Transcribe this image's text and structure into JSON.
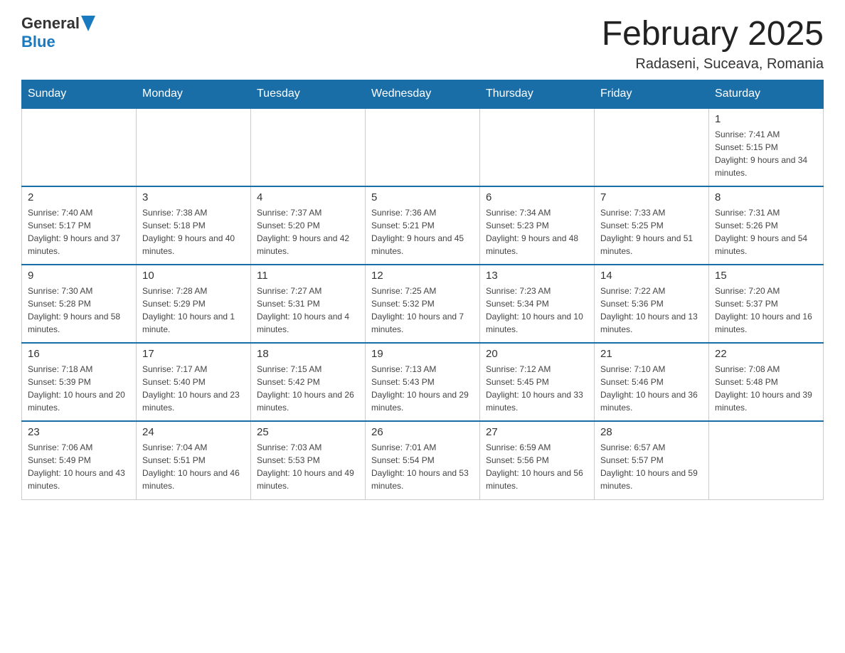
{
  "header": {
    "logo": {
      "general": "General",
      "blue": "Blue"
    },
    "title": "February 2025",
    "location": "Radaseni, Suceava, Romania"
  },
  "weekdays": [
    "Sunday",
    "Monday",
    "Tuesday",
    "Wednesday",
    "Thursday",
    "Friday",
    "Saturday"
  ],
  "weeks": [
    [
      {
        "day": "",
        "info": ""
      },
      {
        "day": "",
        "info": ""
      },
      {
        "day": "",
        "info": ""
      },
      {
        "day": "",
        "info": ""
      },
      {
        "day": "",
        "info": ""
      },
      {
        "day": "",
        "info": ""
      },
      {
        "day": "1",
        "info": "Sunrise: 7:41 AM\nSunset: 5:15 PM\nDaylight: 9 hours and 34 minutes."
      }
    ],
    [
      {
        "day": "2",
        "info": "Sunrise: 7:40 AM\nSunset: 5:17 PM\nDaylight: 9 hours and 37 minutes."
      },
      {
        "day": "3",
        "info": "Sunrise: 7:38 AM\nSunset: 5:18 PM\nDaylight: 9 hours and 40 minutes."
      },
      {
        "day": "4",
        "info": "Sunrise: 7:37 AM\nSunset: 5:20 PM\nDaylight: 9 hours and 42 minutes."
      },
      {
        "day": "5",
        "info": "Sunrise: 7:36 AM\nSunset: 5:21 PM\nDaylight: 9 hours and 45 minutes."
      },
      {
        "day": "6",
        "info": "Sunrise: 7:34 AM\nSunset: 5:23 PM\nDaylight: 9 hours and 48 minutes."
      },
      {
        "day": "7",
        "info": "Sunrise: 7:33 AM\nSunset: 5:25 PM\nDaylight: 9 hours and 51 minutes."
      },
      {
        "day": "8",
        "info": "Sunrise: 7:31 AM\nSunset: 5:26 PM\nDaylight: 9 hours and 54 minutes."
      }
    ],
    [
      {
        "day": "9",
        "info": "Sunrise: 7:30 AM\nSunset: 5:28 PM\nDaylight: 9 hours and 58 minutes."
      },
      {
        "day": "10",
        "info": "Sunrise: 7:28 AM\nSunset: 5:29 PM\nDaylight: 10 hours and 1 minute."
      },
      {
        "day": "11",
        "info": "Sunrise: 7:27 AM\nSunset: 5:31 PM\nDaylight: 10 hours and 4 minutes."
      },
      {
        "day": "12",
        "info": "Sunrise: 7:25 AM\nSunset: 5:32 PM\nDaylight: 10 hours and 7 minutes."
      },
      {
        "day": "13",
        "info": "Sunrise: 7:23 AM\nSunset: 5:34 PM\nDaylight: 10 hours and 10 minutes."
      },
      {
        "day": "14",
        "info": "Sunrise: 7:22 AM\nSunset: 5:36 PM\nDaylight: 10 hours and 13 minutes."
      },
      {
        "day": "15",
        "info": "Sunrise: 7:20 AM\nSunset: 5:37 PM\nDaylight: 10 hours and 16 minutes."
      }
    ],
    [
      {
        "day": "16",
        "info": "Sunrise: 7:18 AM\nSunset: 5:39 PM\nDaylight: 10 hours and 20 minutes."
      },
      {
        "day": "17",
        "info": "Sunrise: 7:17 AM\nSunset: 5:40 PM\nDaylight: 10 hours and 23 minutes."
      },
      {
        "day": "18",
        "info": "Sunrise: 7:15 AM\nSunset: 5:42 PM\nDaylight: 10 hours and 26 minutes."
      },
      {
        "day": "19",
        "info": "Sunrise: 7:13 AM\nSunset: 5:43 PM\nDaylight: 10 hours and 29 minutes."
      },
      {
        "day": "20",
        "info": "Sunrise: 7:12 AM\nSunset: 5:45 PM\nDaylight: 10 hours and 33 minutes."
      },
      {
        "day": "21",
        "info": "Sunrise: 7:10 AM\nSunset: 5:46 PM\nDaylight: 10 hours and 36 minutes."
      },
      {
        "day": "22",
        "info": "Sunrise: 7:08 AM\nSunset: 5:48 PM\nDaylight: 10 hours and 39 minutes."
      }
    ],
    [
      {
        "day": "23",
        "info": "Sunrise: 7:06 AM\nSunset: 5:49 PM\nDaylight: 10 hours and 43 minutes."
      },
      {
        "day": "24",
        "info": "Sunrise: 7:04 AM\nSunset: 5:51 PM\nDaylight: 10 hours and 46 minutes."
      },
      {
        "day": "25",
        "info": "Sunrise: 7:03 AM\nSunset: 5:53 PM\nDaylight: 10 hours and 49 minutes."
      },
      {
        "day": "26",
        "info": "Sunrise: 7:01 AM\nSunset: 5:54 PM\nDaylight: 10 hours and 53 minutes."
      },
      {
        "day": "27",
        "info": "Sunrise: 6:59 AM\nSunset: 5:56 PM\nDaylight: 10 hours and 56 minutes."
      },
      {
        "day": "28",
        "info": "Sunrise: 6:57 AM\nSunset: 5:57 PM\nDaylight: 10 hours and 59 minutes."
      },
      {
        "day": "",
        "info": ""
      }
    ]
  ]
}
